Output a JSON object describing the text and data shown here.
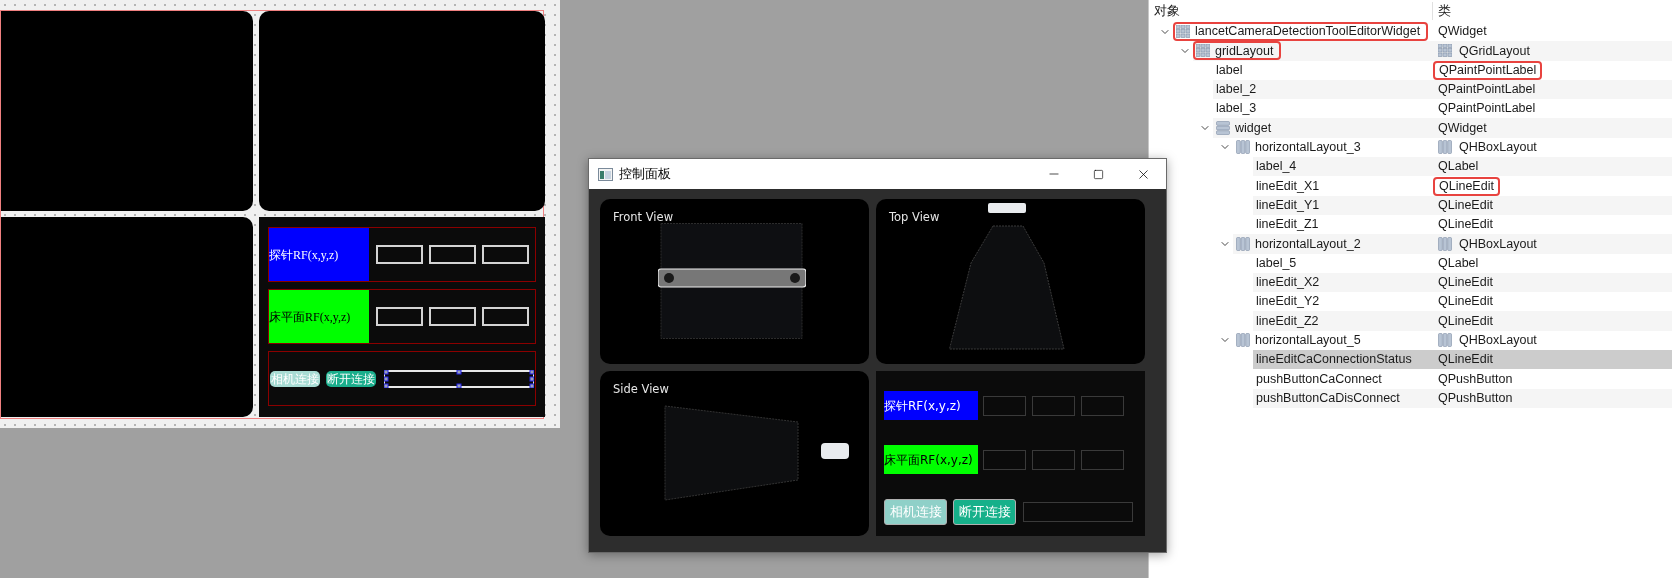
{
  "designer_form": {
    "rows": [
      {
        "label": "探针RF(x,y,z)",
        "color": "#0000ff"
      },
      {
        "label": "床平面RF(x,y,z)",
        "color": "#00ff00"
      }
    ],
    "buttons": [
      {
        "label": "相机连接",
        "color": "#a8dcd4"
      },
      {
        "label": "断开连接",
        "color": "#1aae8c"
      }
    ],
    "status_field": {
      "selected": true
    }
  },
  "dialog": {
    "title": "控制面板",
    "views": [
      {
        "title": "Front View",
        "kind": "front"
      },
      {
        "title": "Top View",
        "kind": "top"
      },
      {
        "title": "Side View",
        "kind": "side"
      }
    ],
    "rows": [
      {
        "label": "探针RF(x,y,z)",
        "color": "#0000ff"
      },
      {
        "label": "床平面RF(x,y,z)",
        "color": "#00ff00"
      }
    ],
    "buttons": [
      {
        "label": "相机连接",
        "color": "#8fd0c8"
      },
      {
        "label": "断开连接",
        "color": "#16b08a"
      }
    ]
  },
  "object_inspector": {
    "columns": [
      "对象",
      "类"
    ],
    "tree": [
      {
        "name": "lancetCameraDetectionToolEditorWidget",
        "class": "QWidget",
        "kind": "form",
        "expanded": true,
        "selected": false,
        "name_outlined": true,
        "class_outlined": false,
        "children": [
          {
            "name": "gridLayout",
            "class": "QGridLayout",
            "kind": "grid",
            "expanded": true,
            "selected": false,
            "name_outlined": true,
            "class_outlined": false,
            "children": [
              {
                "name": "label",
                "class": "QPaintPointLabel",
                "selected": false,
                "name_outlined": false,
                "class_outlined": true
              },
              {
                "name": "label_2",
                "class": "QPaintPointLabel",
                "selected": false,
                "name_outlined": false,
                "class_outlined": false
              },
              {
                "name": "label_3",
                "class": "QPaintPointLabel",
                "selected": false,
                "name_outlined": false,
                "class_outlined": false
              },
              {
                "name": "widget",
                "class": "QWidget",
                "kind": "container",
                "expanded": true,
                "selected": false,
                "name_outlined": false,
                "class_outlined": false,
                "children": [
                  {
                    "name": "horizontalLayout_3",
                    "class": "QHBoxLayout",
                    "kind": "hbox",
                    "expanded": true,
                    "selected": false,
                    "name_outlined": false,
                    "class_outlined": false,
                    "children": [
                      {
                        "name": "label_4",
                        "class": "QLabel",
                        "selected": false,
                        "name_outlined": false,
                        "class_outlined": false
                      },
                      {
                        "name": "lineEdit_X1",
                        "class": "QLineEdit",
                        "selected": false,
                        "name_outlined": false,
                        "class_outlined": true
                      },
                      {
                        "name": "lineEdit_Y1",
                        "class": "QLineEdit",
                        "selected": false,
                        "name_outlined": false,
                        "class_outlined": false
                      },
                      {
                        "name": "lineEdit_Z1",
                        "class": "QLineEdit",
                        "selected": false,
                        "name_outlined": false,
                        "class_outlined": false
                      }
                    ]
                  },
                  {
                    "name": "horizontalLayout_2",
                    "class": "QHBoxLayout",
                    "kind": "hbox",
                    "expanded": true,
                    "selected": false,
                    "name_outlined": false,
                    "class_outlined": false,
                    "children": [
                      {
                        "name": "label_5",
                        "class": "QLabel",
                        "selected": false,
                        "name_outlined": false,
                        "class_outlined": false
                      },
                      {
                        "name": "lineEdit_X2",
                        "class": "QLineEdit",
                        "selected": false,
                        "name_outlined": false,
                        "class_outlined": false
                      },
                      {
                        "name": "lineEdit_Y2",
                        "class": "QLineEdit",
                        "selected": false,
                        "name_outlined": false,
                        "class_outlined": false
                      },
                      {
                        "name": "lineEdit_Z2",
                        "class": "QLineEdit",
                        "selected": false,
                        "name_outlined": false,
                        "class_outlined": false
                      }
                    ]
                  },
                  {
                    "name": "horizontalLayout_5",
                    "class": "QHBoxLayout",
                    "kind": "hbox",
                    "expanded": true,
                    "selected": false,
                    "name_outlined": false,
                    "class_outlined": false,
                    "children": [
                      {
                        "name": "lineEditCaConnectionStatus",
                        "class": "QLineEdit",
                        "selected": true,
                        "name_outlined": false,
                        "class_outlined": false
                      },
                      {
                        "name": "pushButtonCaConnect",
                        "class": "QPushButton",
                        "selected": false,
                        "name_outlined": false,
                        "class_outlined": false
                      },
                      {
                        "name": "pushButtonCaDisConnect",
                        "class": "QPushButton",
                        "selected": false,
                        "name_outlined": false,
                        "class_outlined": false
                      }
                    ]
                  }
                ]
              }
            ]
          }
        ]
      }
    ]
  }
}
